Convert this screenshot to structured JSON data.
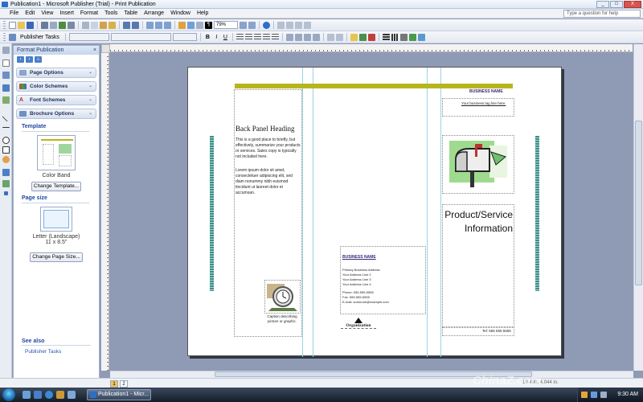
{
  "window": {
    "title": "Publication1 - Microsoft Publisher (Trial) - Print Publication",
    "min": "_",
    "max": "□",
    "close": "X"
  },
  "menu": [
    "File",
    "Edit",
    "View",
    "Insert",
    "Format",
    "Tools",
    "Table",
    "Arrange",
    "Window",
    "Help"
  ],
  "help_placeholder": "Type a question for help",
  "toolbar": {
    "zoom": "79%",
    "publisher_tasks": "Publisher Tasks"
  },
  "task_pane": {
    "title": "Format Publication",
    "sections": [
      {
        "label": "Page Options",
        "icon": "page-options-icon"
      },
      {
        "label": "Color Schemes",
        "icon": "color-schemes-icon"
      },
      {
        "label": "Font Schemes",
        "icon": "font-schemes-icon"
      },
      {
        "label": "Brochure Options",
        "icon": "brochure-options-icon"
      }
    ],
    "template_label": "Template",
    "template_name": "Color Band",
    "change_template": "Change Template...",
    "page_size_label": "Page size",
    "page_size_name": "Letter (Landscape)",
    "page_size_dims": "11 x 8.5\"",
    "change_page_size": "Change Page Size...",
    "see_also": "See also",
    "see_also_link": "Publisher Tasks"
  },
  "publication": {
    "back_panel_heading": "Back Panel Heading",
    "back_panel_body1": "This is a good place to briefly, but effectively, summarize your products or services. Sales copy is typically not included here.",
    "back_panel_body2": "Lorem ipsum dolor sit amet, consectetuer adipiscing elit, sed diam nonummy nibh euismod tincidunt ut laoreet dolor et accumsan.",
    "caption": "Caption describing picture or graphic.",
    "mid_business_name": "BUSINESS NAME",
    "address": [
      "Primary Business Address",
      "Your Address Line 2",
      "Your Address Line 3",
      "Your Address Line 4"
    ],
    "contact": [
      "Phone: 555-555-5555",
      "Fax: 555-555-5555",
      "E-mail: someone@example.com"
    ],
    "org_label": "Organization",
    "right_business_name": "BUSINESS NAME",
    "tagline": "Your business tag line here.",
    "product_title": "Product/Service Information",
    "tel": "Tel: 555 555 5555"
  },
  "statusbar": {
    "pages": [
      "1",
      "2"
    ],
    "coords": "10.408, 4.044 in."
  },
  "taskbar": {
    "task_button": "Publication1 - Micr...",
    "clock": "9:30 AM"
  },
  "watermark": "ChinaZ.com",
  "colors": {
    "olive_band": "#b7b51d",
    "teal_band": "#3f8f8a",
    "taskpane_header": "#2147a0"
  }
}
